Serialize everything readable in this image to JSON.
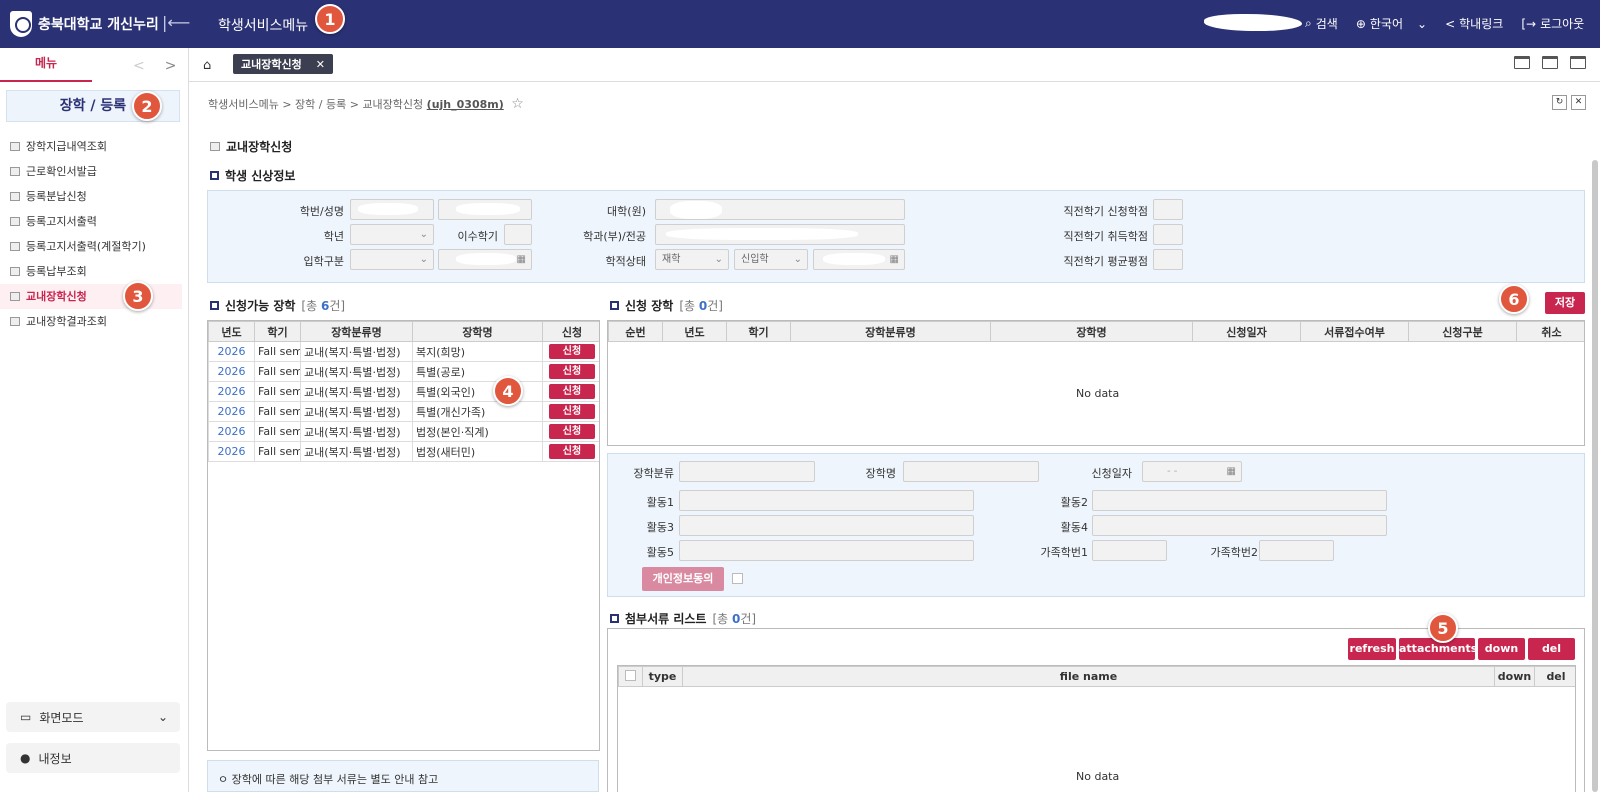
{
  "header": {
    "logo_text": "충북대학교 개신누리",
    "collapse_icon": "collapse-left-icon",
    "title": "학생서비스메뉴",
    "actions": [
      {
        "label": "검색",
        "icon": "search-icon"
      },
      {
        "label": "한국어",
        "icon": "globe-icon"
      },
      {
        "label": "학내링크",
        "icon": "share-icon"
      },
      {
        "label": "로그아웃",
        "icon": "logout-icon"
      }
    ]
  },
  "badges": [
    "1",
    "2",
    "3",
    "4",
    "5",
    "6"
  ],
  "sidebar": {
    "tab": "메뉴",
    "section_title": "장학 / 등록",
    "items": [
      {
        "label": "장학지급내역조회"
      },
      {
        "label": "근로확인서발급"
      },
      {
        "label": "등록분납신청"
      },
      {
        "label": "등록고지서출력"
      },
      {
        "label": "등록고지서출력(계절학기)"
      },
      {
        "label": "등록납부조회"
      },
      {
        "label": "교내장학신청"
      },
      {
        "label": "교내장학결과조회"
      }
    ],
    "screen_mode": "화면모드",
    "my_info": "내정보"
  },
  "tabbar": {
    "open_tab": "교내장학신청",
    "close": "✕"
  },
  "breadcrumb": {
    "path": "학생서비스메뉴 > 장학 / 등록 > 교내장학신청",
    "code": "(ujh_0308m)"
  },
  "page_title": "교내장학신청",
  "student_info": {
    "section_title": "학생 신상정보",
    "labels": {
      "student_no": "학번/성명",
      "grade": "학년",
      "completed_term": "이수학기",
      "admission_type": "입학구분",
      "college": "대학(원)",
      "department": "학과(부)/전공",
      "status": "학적상태",
      "prev_applied": "직전학기 신청학점",
      "prev_earned": "직전학기 취득학점",
      "prev_gpa": "직전학기 평균평점"
    },
    "status_value": "재학",
    "status_sub_value": "신입학"
  },
  "available": {
    "title": "신청가능 장학",
    "count_prefix": "[총 ",
    "count": "6",
    "count_suffix": "건]",
    "columns": [
      "년도",
      "학기",
      "장학분류명",
      "장학명",
      "신청"
    ],
    "rows": [
      {
        "year": "2026",
        "term": "Fall semester",
        "category": "교내(복지·특별·법정)",
        "name": "복지(희망)",
        "action": "신청"
      },
      {
        "year": "2026",
        "term": "Fall semester",
        "category": "교내(복지·특별·법정)",
        "name": "특별(공로)",
        "action": "신청"
      },
      {
        "year": "2026",
        "term": "Fall semester",
        "category": "교내(복지·특별·법정)",
        "name": "특별(외국인)",
        "action": "신청"
      },
      {
        "year": "2026",
        "term": "Fall semester",
        "category": "교내(복지·특별·법정)",
        "name": "특별(개신가족)",
        "action": "신청"
      },
      {
        "year": "2026",
        "term": "Fall semester",
        "category": "교내(복지·특별·법정)",
        "name": "법정(본인·직계)",
        "action": "신청"
      },
      {
        "year": "2026",
        "term": "Fall semester",
        "category": "교내(복지·특별·법정)",
        "name": "법정(새터민)",
        "action": "신청"
      }
    ],
    "note": "ㅇ 장학에 따른 해당 첨부 서류는 별도 안내 참고"
  },
  "applied": {
    "title": "신청 장학",
    "count_prefix": "[총 ",
    "count": "0",
    "count_suffix": "건]",
    "save": "저장",
    "columns": [
      "순번",
      "년도",
      "학기",
      "장학분류명",
      "장학명",
      "신청일자",
      "서류접수여부",
      "신청구분",
      "취소"
    ],
    "empty": "No data"
  },
  "form": {
    "category": "장학분류",
    "name": "장학명",
    "date": "신청일자",
    "date_placeholder": "-  -",
    "act1": "활동1",
    "act2": "활동2",
    "act3": "활동3",
    "act4": "활동4",
    "act5": "활동5",
    "family1": "가족학번1",
    "family2": "가족학번2",
    "consent": "개인정보동의"
  },
  "attachments": {
    "title": "첨부서류 리스트",
    "count_prefix": "[총 ",
    "count": "0",
    "count_suffix": "건]",
    "buttons": [
      "refresh",
      "attachments",
      "down",
      "del"
    ],
    "columns": [
      "type",
      "file name",
      "down",
      "del"
    ],
    "empty": "No data"
  },
  "colors": {
    "primary_navy": "#2b3175",
    "accent_red": "#c8264f",
    "panel_blue": "#eef5fc",
    "badge_orange": "#e0573e"
  }
}
